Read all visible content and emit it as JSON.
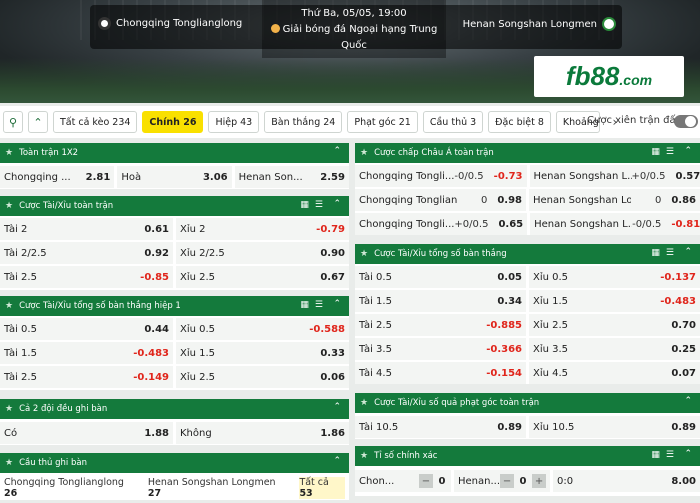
{
  "header": {
    "home_team": "Chongqing Tongliangl​ong",
    "away_team": "Henan Songshan Longmen",
    "datetime": "Thứ Ba, 05/05, 19:00",
    "league_line1": "Giải bóng đá Ngoại hạng Trung",
    "league_line2": "Quốc",
    "logo_main": "fb88",
    "logo_suffix": ".com"
  },
  "tabs": [
    "Tất cả kèo 234",
    "Chính 26",
    "Hiệp 43",
    "Bàn thắng 24",
    "Phạt góc 21",
    "Cầu thủ 3",
    "Đặc biệt 8",
    "Khoảng"
  ],
  "parlay_label": "Cược xiên trận đấu",
  "left": {
    "p1x2": {
      "title": "Toàn trận 1X2",
      "home": "Chongqing ...",
      "home_v": "2.81",
      "draw": "Hoà",
      "draw_v": "3.06",
      "away": "Henan Son...",
      "away_v": "2.59"
    },
    "ou": {
      "title": "Cược Tài/Xỉu toàn trận",
      "rows": [
        [
          "Tài 2",
          "0.61",
          "Xỉu 2",
          "-0.79"
        ],
        [
          "Tài 2/2.5",
          "0.92",
          "Xỉu 2/2.5",
          "0.90"
        ],
        [
          "Tài 2.5",
          "-0.85",
          "Xỉu 2.5",
          "0.67"
        ]
      ]
    },
    "ouh1": {
      "title": "Cược Tài/Xỉu tổng số bàn thắng hiệp 1",
      "rows": [
        [
          "Tài 0.5",
          "0.44",
          "Xỉu 0.5",
          "-0.588"
        ],
        [
          "Tài 1.5",
          "-0.483",
          "Xỉu 1.5",
          "0.33"
        ],
        [
          "Tài 2.5",
          "-0.149",
          "Xỉu 2.5",
          "0.06"
        ]
      ]
    },
    "btts": {
      "title": "Cả 2 đội đều ghi bàn",
      "yes": "Có",
      "yes_v": "1.88",
      "no": "Không",
      "no_v": "1.86"
    },
    "scorer": {
      "title": "Cầu thủ ghi bàn",
      "home": "Chongqing Tongliangl​ong",
      "home_n": "26",
      "away": "Henan Songshan Longmen",
      "away_n": "27",
      "all": "Tất cả",
      "all_n": "53"
    }
  },
  "right": {
    "ah": {
      "title": "Cược chấp Châu Á toàn trận",
      "rows": [
        [
          "Chongqing Tongli...",
          "-0/0.5",
          "-0.73",
          "Henan Songshan L...",
          "+0/0.5",
          "0.57"
        ],
        [
          "Chongqing Tongliangl​o...",
          "0",
          "0.98",
          "Henan Songshan Long...",
          "0",
          "0.86"
        ],
        [
          "Chongqing Tongli...",
          "+0/0.5",
          "0.65",
          "Henan Songshan L...",
          "-0/0.5",
          "-0.81"
        ]
      ]
    },
    "ougoals": {
      "title": "Cược Tài/Xỉu tổng số bàn thắng",
      "rows": [
        [
          "Tài 0.5",
          "0.05",
          "Xỉu 0.5",
          "-0.137"
        ],
        [
          "Tài 1.5",
          "0.34",
          "Xỉu 1.5",
          "-0.483"
        ],
        [
          "Tài 2.5",
          "-0.885",
          "Xỉu 2.5",
          "0.70"
        ],
        [
          "Tài 3.5",
          "-0.366",
          "Xỉu 3.5",
          "0.25"
        ],
        [
          "Tài 4.5",
          "-0.154",
          "Xỉu 4.5",
          "0.07"
        ]
      ]
    },
    "corners": {
      "title": "Cược Tài/Xỉu số quả phạt góc toàn trận",
      "rows": [
        [
          "Tài 10.5",
          "0.89",
          "Xỉu 10.5",
          "0.89"
        ]
      ]
    },
    "exact": {
      "title": "Tỉ số chính xác",
      "home": "Chon...",
      "home_score": "0",
      "away": "Henan...",
      "away_score": "0",
      "result": "0:0",
      "odds": "8.00"
    }
  }
}
